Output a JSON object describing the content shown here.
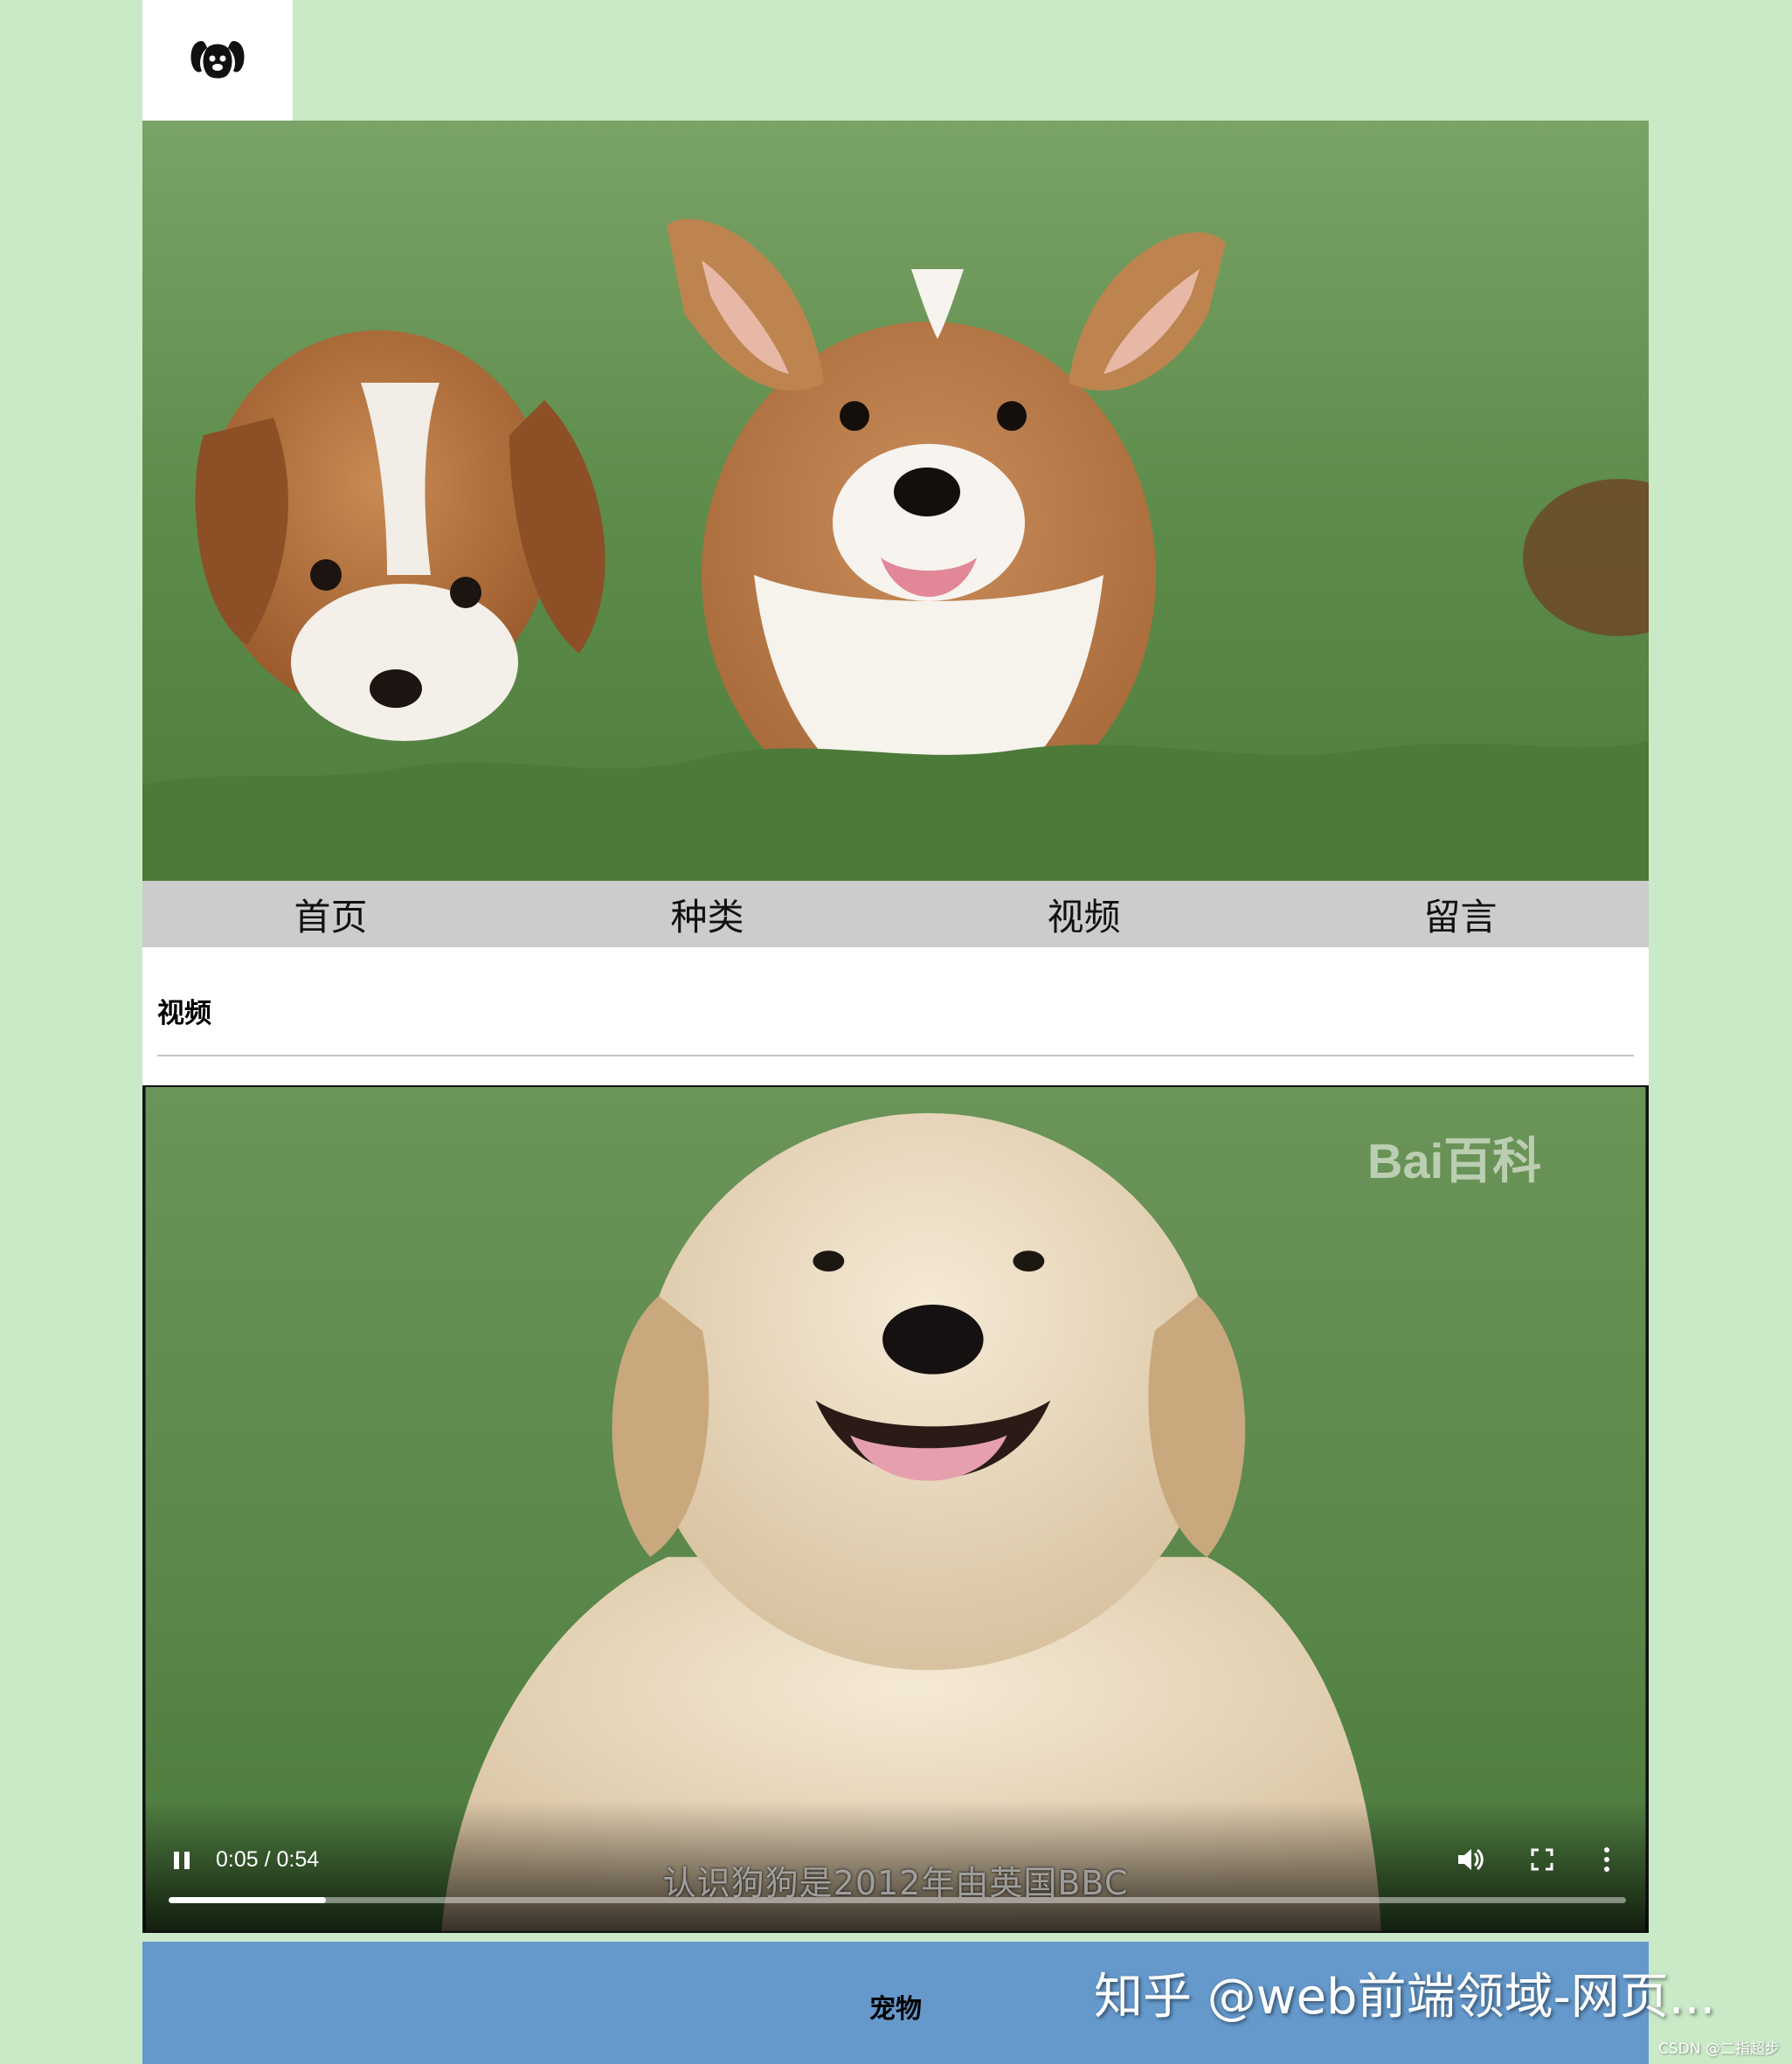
{
  "header": {
    "logo_icon": "dog-paw-logo-icon"
  },
  "banner": {
    "image": "corgi-puppies-on-grass"
  },
  "nav": {
    "items": [
      {
        "label": "首页"
      },
      {
        "label": "种类"
      },
      {
        "label": "视频"
      },
      {
        "label": "留言"
      }
    ]
  },
  "section": {
    "title": "视频"
  },
  "video": {
    "time": "0:05 / 0:54",
    "progress": 0.108,
    "subtitle": "认识狗狗是2012年由英国BBC",
    "logo": "Bai百科",
    "controls": [
      "pause-icon",
      "volume-icon",
      "fullscreen-icon",
      "more-options-icon"
    ]
  },
  "footer": {
    "title": "宠物"
  },
  "overlay": {
    "watermark": "知乎 @web前端领域-网页...",
    "csdn": "CSDN @二指超步"
  },
  "colors": {
    "page_bg": "#c9e9c7",
    "nav_bg": "#cccccc",
    "footer_bg": "#6599cc"
  }
}
